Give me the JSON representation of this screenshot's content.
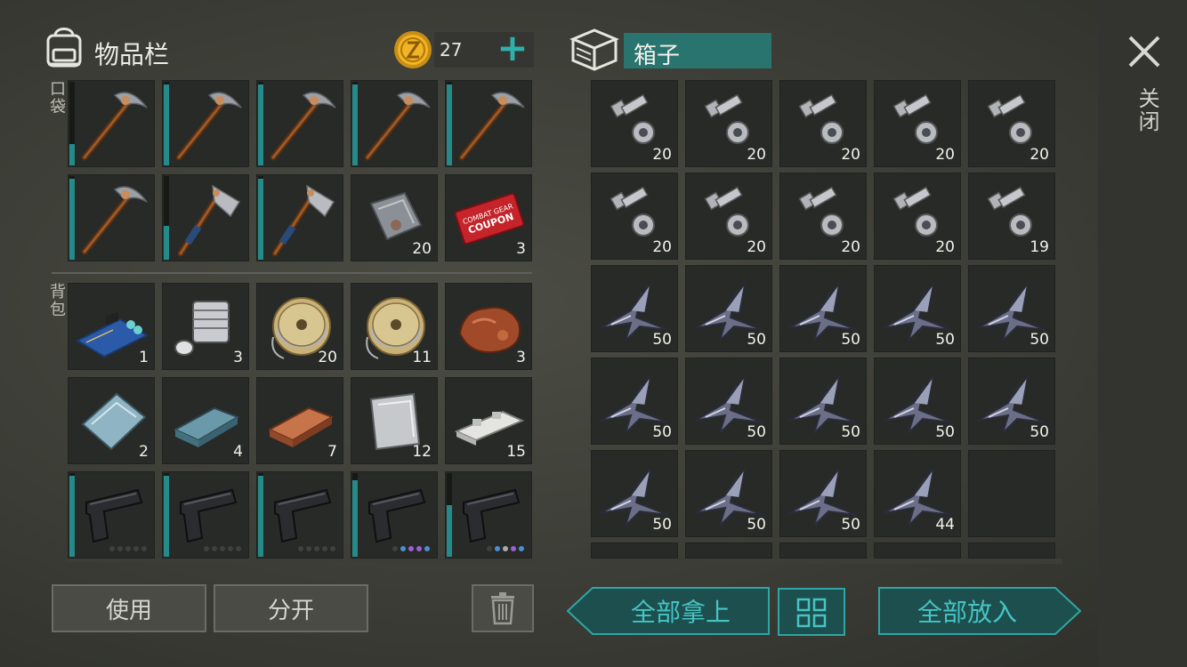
{
  "inventory": {
    "title": "物品栏",
    "coins": "27",
    "add_label": "+",
    "pocket_label": "口袋",
    "backpack_label": "背包"
  },
  "pocket_slots": [
    {
      "item": "pickaxe-icon",
      "count": "",
      "durability": 0.25
    },
    {
      "item": "pickaxe-icon",
      "count": "",
      "durability": 0.95
    },
    {
      "item": "pickaxe-icon",
      "count": "",
      "durability": 0.95
    },
    {
      "item": "pickaxe-icon",
      "count": "",
      "durability": 0.95
    },
    {
      "item": "pickaxe-icon",
      "count": "",
      "durability": 0.95
    },
    {
      "item": "pickaxe-icon",
      "count": "",
      "durability": 0.95
    },
    {
      "item": "hatchet-icon",
      "count": "",
      "durability": 0.4
    },
    {
      "item": "hatchet-icon",
      "count": "",
      "durability": 0.95
    },
    {
      "item": "metal-plate-icon",
      "count": "20",
      "durability": null
    },
    {
      "item": "combat-coupon-icon",
      "count": "3",
      "durability": null
    }
  ],
  "backpack_slots": [
    {
      "item": "circuit-board-icon",
      "count": "1",
      "durability": null
    },
    {
      "item": "engine-cylinder-icon",
      "count": "3",
      "durability": null
    },
    {
      "item": "wire-spool-icon",
      "count": "20",
      "durability": null
    },
    {
      "item": "wire-spool-icon",
      "count": "11",
      "durability": null
    },
    {
      "item": "copper-ore-icon",
      "count": "3",
      "durability": null
    },
    {
      "item": "steel-plate-icon",
      "count": "2",
      "durability": null
    },
    {
      "item": "iron-ingot-icon",
      "count": "4",
      "durability": null
    },
    {
      "item": "copper-ingot-icon",
      "count": "7",
      "durability": null
    },
    {
      "item": "aluminum-sheet-icon",
      "count": "12",
      "durability": null
    },
    {
      "item": "aluminum-bar-icon",
      "count": "15",
      "durability": null
    },
    {
      "item": "pistol-icon",
      "count": "",
      "durability": 0.95,
      "dots": [
        "#3f413d",
        "#3f413d",
        "#3f413d",
        "#3f413d",
        "#3f413d"
      ]
    },
    {
      "item": "pistol-icon",
      "count": "",
      "durability": 0.95,
      "dots": [
        "#3f413d",
        "#3f413d",
        "#3f413d",
        "#3f413d",
        "#3f413d"
      ]
    },
    {
      "item": "pistol-icon",
      "count": "",
      "durability": 0.95,
      "dots": [
        "#3f413d",
        "#3f413d",
        "#3f413d",
        "#3f413d",
        "#3f413d"
      ]
    },
    {
      "item": "pistol-icon",
      "count": "",
      "durability": 0.9,
      "dots": [
        "#3f413d",
        "#4a8fd0",
        "#9b5fd6",
        "#9b5fd6",
        "#4a8fd0"
      ]
    },
    {
      "item": "pistol-icon",
      "count": "",
      "durability": 0.6,
      "dots": [
        "#3f413d",
        "#4a8fd0",
        "#aaaaaa",
        "#9b5fd6",
        "#4a8fd0"
      ]
    }
  ],
  "box": {
    "title": "箱子",
    "slots": [
      {
        "item": "bolts-nuts-icon",
        "count": "20"
      },
      {
        "item": "bolts-nuts-icon",
        "count": "20"
      },
      {
        "item": "bolts-nuts-icon",
        "count": "20"
      },
      {
        "item": "bolts-nuts-icon",
        "count": "20"
      },
      {
        "item": "bolts-nuts-icon",
        "count": "20"
      },
      {
        "item": "bolts-nuts-icon",
        "count": "20"
      },
      {
        "item": "bolts-nuts-icon",
        "count": "20"
      },
      {
        "item": "bolts-nuts-icon",
        "count": "20"
      },
      {
        "item": "bolts-nuts-icon",
        "count": "20"
      },
      {
        "item": "bolts-nuts-icon",
        "count": "19"
      },
      {
        "item": "metal-scrap-icon",
        "count": "50"
      },
      {
        "item": "metal-scrap-icon",
        "count": "50"
      },
      {
        "item": "metal-scrap-icon",
        "count": "50"
      },
      {
        "item": "metal-scrap-icon",
        "count": "50"
      },
      {
        "item": "metal-scrap-icon",
        "count": "50"
      },
      {
        "item": "metal-scrap-icon",
        "count": "50"
      },
      {
        "item": "metal-scrap-icon",
        "count": "50"
      },
      {
        "item": "metal-scrap-icon",
        "count": "50"
      },
      {
        "item": "metal-scrap-icon",
        "count": "50"
      },
      {
        "item": "metal-scrap-icon",
        "count": "50"
      },
      {
        "item": "metal-scrap-icon",
        "count": "50"
      },
      {
        "item": "metal-scrap-icon",
        "count": "50"
      },
      {
        "item": "metal-scrap-icon",
        "count": "50"
      },
      {
        "item": "metal-scrap-icon",
        "count": "44"
      },
      {
        "item": "",
        "count": ""
      }
    ]
  },
  "buttons": {
    "use": "使用",
    "split": "分开",
    "take_all": "全部拿上",
    "put_all": "全部放入",
    "close": "关闭"
  },
  "colors": {
    "accent": "#2a8c8c",
    "accent_text": "#46c4c4",
    "durability": "#258a8a"
  }
}
